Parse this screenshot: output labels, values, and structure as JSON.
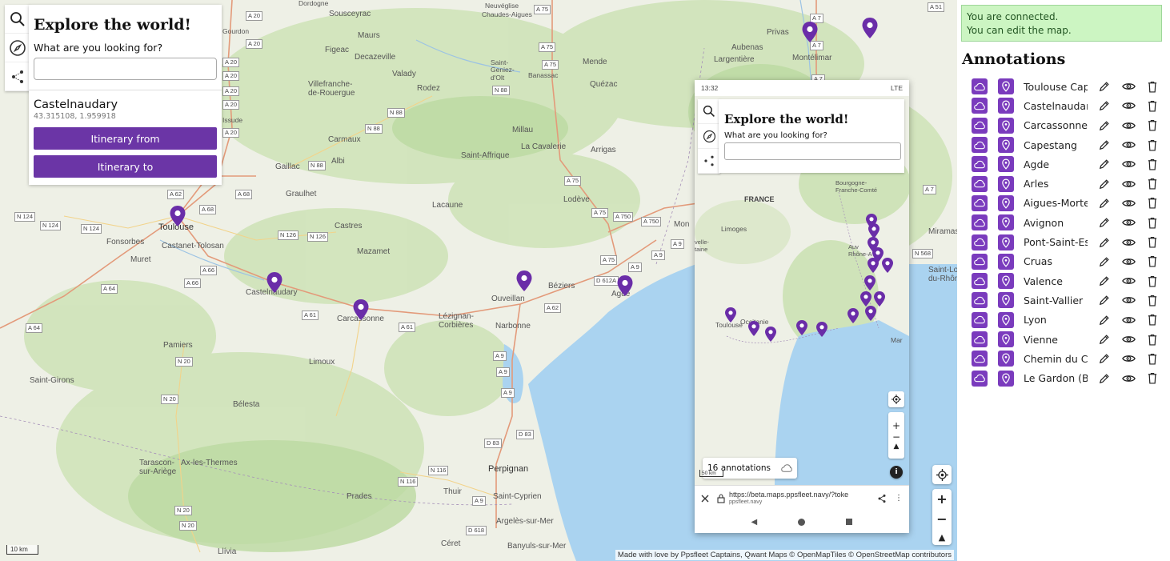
{
  "search_panel": {
    "title": "Explore the world!",
    "question": "What are you looking for?",
    "search_value": "",
    "result_name": "Castelnaudary",
    "result_coords": "43.315108, 1.959918",
    "itinerary_from": "Itinerary from",
    "itinerary_to": "Itinerary to"
  },
  "map": {
    "places": [
      {
        "name": "Toulouse",
        "cls": "city"
      },
      {
        "name": "Fonsorbes"
      },
      {
        "name": "Castanet-Tolosan"
      },
      {
        "name": "Muret"
      },
      {
        "name": "Castelnaudary"
      },
      {
        "name": "Carcassonne"
      },
      {
        "name": "Pamiers"
      },
      {
        "name": "Limoux"
      },
      {
        "name": "Saint-Girons"
      },
      {
        "name": "Tarascon-\nsur-Ariège"
      },
      {
        "name": "Ax-les-Thermes"
      },
      {
        "name": "Prades"
      },
      {
        "name": "Llívia"
      },
      {
        "name": "Perpignan"
      },
      {
        "name": "Thuir"
      },
      {
        "name": "Saint-Cyprien"
      },
      {
        "name": "Argelès-sur-Mer"
      },
      {
        "name": "Céret"
      },
      {
        "name": "Banyuls-sur-Mer"
      },
      {
        "name": "Narbonne"
      },
      {
        "name": "Lézignan-\nCorbières"
      },
      {
        "name": "Ouveillan"
      },
      {
        "name": "Béziers"
      },
      {
        "name": "Agde"
      },
      {
        "name": "Bélesta"
      },
      {
        "name": "Mazamet"
      },
      {
        "name": "Castres"
      },
      {
        "name": "Graulhet"
      },
      {
        "name": "Gaillac"
      },
      {
        "name": "Albi"
      },
      {
        "name": "Carmaux"
      },
      {
        "name": "Villefranche-\nde-Rouergue"
      },
      {
        "name": "Decazeville"
      },
      {
        "name": "Figeac"
      },
      {
        "name": "Rodez"
      },
      {
        "name": "Millau"
      },
      {
        "name": "Saint-Affrique"
      },
      {
        "name": "La Cavalerie"
      },
      {
        "name": "Lacaune"
      },
      {
        "name": "Lodève"
      },
      {
        "name": "Arrigas"
      },
      {
        "name": "Valady"
      },
      {
        "name": "Maurs"
      },
      {
        "name": "Sousceyrac"
      },
      {
        "name": "Saint-\nGeniez-\nd'Olt"
      },
      {
        "name": "Banassac"
      },
      {
        "name": "Mende"
      },
      {
        "name": "Quézac"
      },
      {
        "name": "Aubenas"
      },
      {
        "name": "Largentière"
      },
      {
        "name": "Privas"
      },
      {
        "name": "Montélimar"
      },
      {
        "name": "Neuvéglise"
      },
      {
        "name": "Chaudes-Aigues"
      },
      {
        "name": "Dordogne"
      },
      {
        "name": "Mon"
      },
      {
        "name": "Miramas"
      },
      {
        "name": "Saint-Louis-\ndu-Rhône"
      },
      {
        "name": "Gourdon"
      },
      {
        "name": "Issude"
      }
    ],
    "roads": [
      "A 20",
      "A 20",
      "A 20",
      "A 20",
      "A 20",
      "A 20",
      "A 20",
      "A 62",
      "A 68",
      "A 68",
      "A 66",
      "A 66",
      "A 64",
      "A 64",
      "A 61",
      "A 61",
      "A 75",
      "A 75",
      "A 75",
      "A 75",
      "A 75",
      "A 75",
      "A 750",
      "A 750",
      "A 9",
      "A 9",
      "A 9",
      "A 9",
      "A 9",
      "A 9",
      "A 9",
      "A 7",
      "A 7",
      "A 7",
      "A 7",
      "A 51",
      "N 124",
      "N 124",
      "N 124",
      "N 126",
      "N 126",
      "N 88",
      "N 88",
      "N 88",
      "N 88",
      "N 20",
      "N 20",
      "N 20",
      "N 20",
      "N 116",
      "N 116",
      "D 83",
      "D 83",
      "D 618",
      "D 612A",
      "N 568",
      "A 62"
    ],
    "scale": "10 km",
    "attribution": "Made with love by Ppsfleet Captains, Qwant Maps © OpenMapTiles © OpenStreetMap contributors"
  },
  "phone": {
    "time": "13:32",
    "status_right": "LTE",
    "title": "Explore the world!",
    "question": "What are you looking for?",
    "labels": {
      "france": "FRANCE",
      "limoges": "Limoges",
      "toulouse": "Toulouse",
      "occitanie": "Occitanie",
      "bourgogne": "Bourgogne-\nFranche-Comté",
      "auvergne": "Auv\nRhône-A",
      "marseille": "Mar",
      "nouvelle": "velle-\ntaine"
    },
    "count_label": "16 annotations",
    "scale": "50 km",
    "url": "https://beta.maps.ppsfleet.navy/?toke",
    "url_sub": "ppsfleet.navy"
  },
  "sidebar": {
    "status_line1": "You are connected.",
    "status_line2": "You can edit the map.",
    "title": "Annotations",
    "annotations": [
      "Toulouse Cap",
      "Castelnaudar",
      "Carcassonne",
      "Capestang",
      "Agde",
      "Arles",
      "Aigues-Morte",
      "Avignon",
      "Pont-Saint-Es",
      "Cruas",
      "Valence",
      "Saint-Vallier",
      "Lyon",
      "Vienne",
      "Chemin du Cl",
      "Le Gardon (Bu"
    ]
  },
  "colors": {
    "accent": "#6b35a6",
    "pin": "#6a2da8",
    "connected_bg": "#ccf5c2",
    "sea": "#aad3f0"
  },
  "icons": [
    "search-icon",
    "compass-icon",
    "share-icon",
    "cloud-icon",
    "pin-icon",
    "pencil-icon",
    "eye-icon",
    "trash-icon",
    "locate-icon",
    "zoom-in-icon",
    "zoom-out-icon",
    "compass-arrow-icon",
    "info-icon",
    "close-icon",
    "lock-icon"
  ]
}
